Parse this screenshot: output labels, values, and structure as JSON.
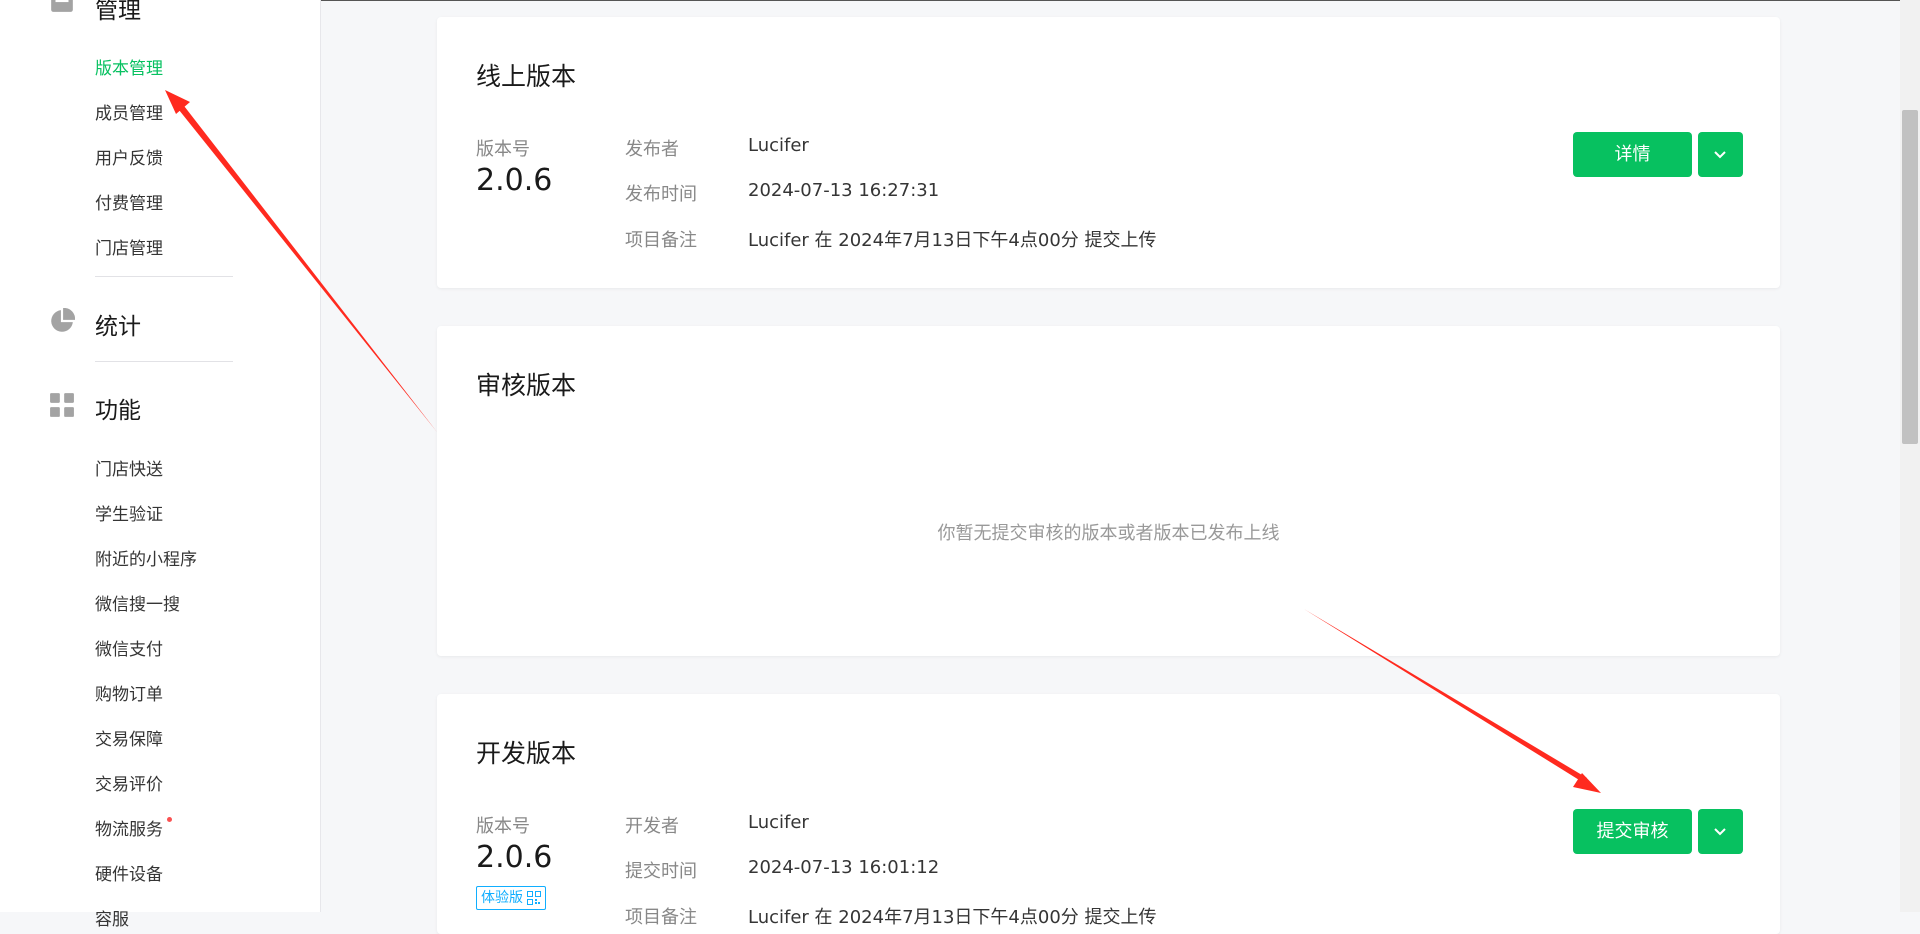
{
  "sidebar": {
    "section_manage": "管理",
    "manage_items": [
      "版本管理",
      "成员管理",
      "用户反馈",
      "付费管理",
      "门店管理"
    ],
    "section_stats": "统计",
    "section_features": "功能",
    "feature_items": [
      "门店快送",
      "学生验证",
      "附近的小程序",
      "微信搜一搜",
      "微信支付",
      "购物订单",
      "交易保障",
      "交易评价",
      "物流服务",
      "硬件设备",
      "容服"
    ],
    "icons": {
      "manage": "inbox-icon",
      "stats": "pie-chart-icon",
      "features": "grid-icon"
    },
    "accent_color": "#07c160"
  },
  "online": {
    "title": "线上版本",
    "version_label": "版本号",
    "version": "2.0.6",
    "publisher_label": "发布者",
    "publisher": "Lucifer",
    "time_label": "发布时间",
    "time": "2024-07-13 16:27:31",
    "note_label": "项目备注",
    "note": "Lucifer 在 2024年7月13日下午4点00分 提交上传",
    "detail_button": "详情"
  },
  "review": {
    "title": "审核版本",
    "empty": "你暂无提交审核的版本或者版本已发布上线"
  },
  "dev": {
    "title": "开发版本",
    "version_label": "版本号",
    "version": "2.0.6",
    "badge": "体验版",
    "developer_label": "开发者",
    "developer": "Lucifer",
    "time_label": "提交时间",
    "time": "2024-07-13 16:01:12",
    "note_label": "项目备注",
    "note": "Lucifer 在 2024年7月13日下午4点00分 提交上传",
    "submit_button": "提交审核"
  },
  "colors": {
    "primary": "#07c160",
    "arrow": "#ff2a1f",
    "badge": "#10aeff",
    "notice_dot": "#fa5151"
  }
}
